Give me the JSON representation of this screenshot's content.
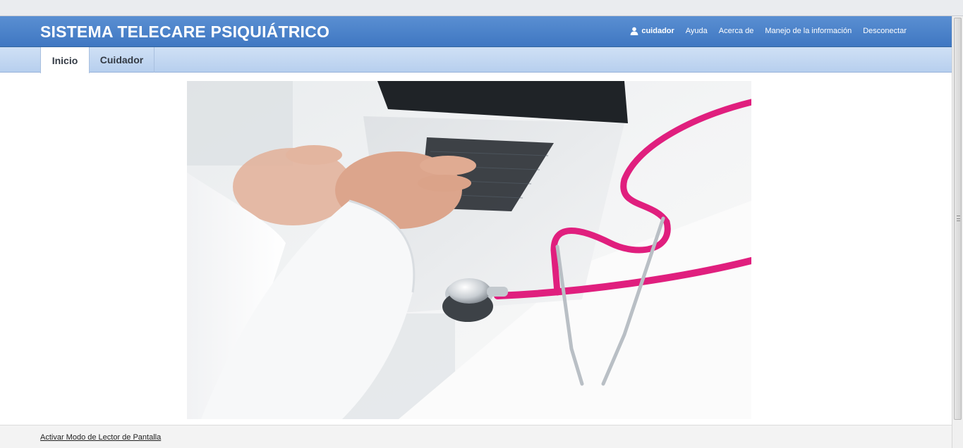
{
  "app": {
    "title": "SISTEMA TELECARE PSIQUIÁTRICO"
  },
  "header": {
    "user_icon": "user-icon",
    "user_name": "cuidador",
    "links": [
      "Ayuda",
      "Acerca de",
      "Manejo de la información",
      "Desconectar"
    ]
  },
  "nav": {
    "tabs": [
      {
        "label": "Inicio",
        "active": true
      },
      {
        "label": "Cuidador",
        "active": false
      }
    ]
  },
  "main": {
    "hero_image": "doctor typing on laptop with pink stethoscope"
  },
  "footer": {
    "screen_reader_link": "Activar Modo de Lector de Pantalla"
  },
  "colors": {
    "header_blue": "#4a80c9",
    "nav_light_blue": "#c3d7f1",
    "stethoscope_pink": "#e01f7e"
  }
}
